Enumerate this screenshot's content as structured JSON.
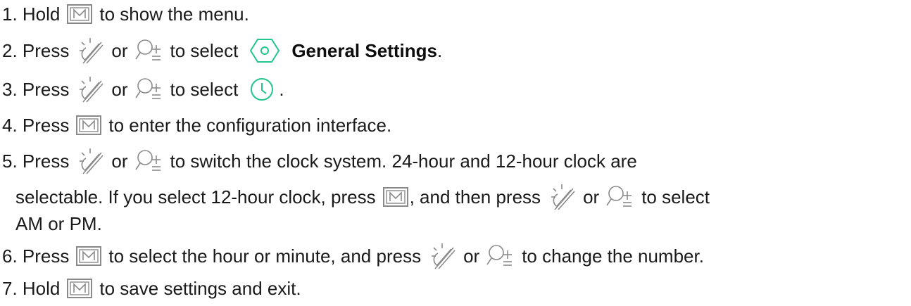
{
  "colors": {
    "text": "#1a1a1a",
    "icon_green": "#22c58b",
    "icon_grey": "#8a8a8a"
  },
  "icons": {
    "m_button": "m-button-icon",
    "brightness": "brightness-icon",
    "zoom": "zoom-icon",
    "settings": "general-settings-icon",
    "clock": "clock-icon"
  },
  "steps": [
    {
      "n": "1. Hold",
      "t1": "to show the menu."
    },
    {
      "n": "2. Press",
      "or": "or",
      "t1": "to select",
      "label": "General Settings",
      "end": "."
    },
    {
      "n": "3. Press",
      "or": "or",
      "t1": "to select",
      "end": "."
    },
    {
      "n": "4. Press",
      "t1": "to enter the configuration interface."
    },
    {
      "n": "5. Press",
      "or": "or",
      "t1": "to switch the clock system. 24-hour and 12-hour clock are",
      "l2a": "selectable. If you select 12-hour clock, press",
      "l2b": ", and then press",
      "l2c": "or",
      "l2d": "to select",
      "l3": "AM or PM."
    },
    {
      "n": "6. Press",
      "t1": "to select the hour or minute, and press",
      "or": "or",
      "t2": "to change the number."
    },
    {
      "n": "7. Hold",
      "t1": "to save settings and exit."
    }
  ]
}
